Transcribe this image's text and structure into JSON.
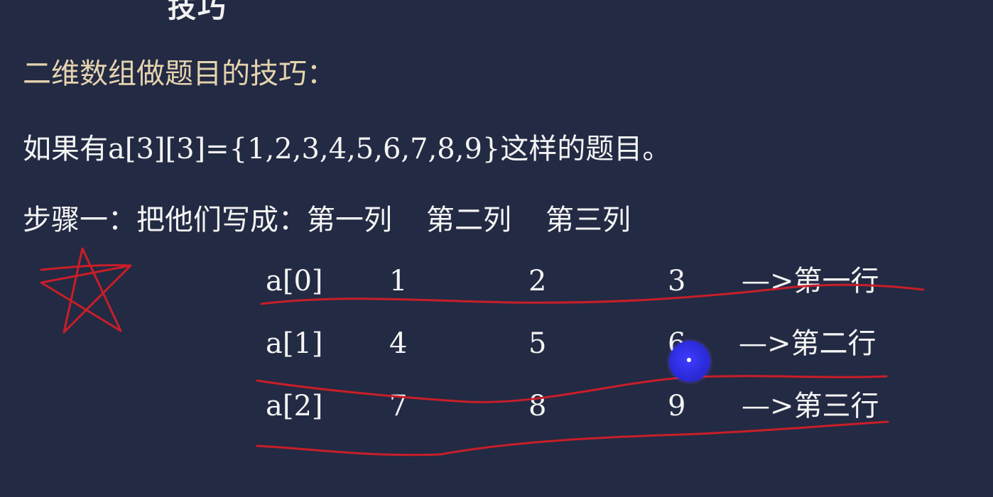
{
  "slide": {
    "top_fragment": "技巧",
    "title": "二维数组做题目的技巧：",
    "example": "如果有a[3][3]={1,2,3,4,5,6,7,8,9}这样的题目。",
    "step_prefix": "步骤一：把他们写成：",
    "column_labels": [
      "第一列",
      "第二列",
      "第三列"
    ]
  },
  "matrix": {
    "rows": [
      {
        "name": "a[0]",
        "values": [
          "1",
          "2",
          "3"
        ],
        "arrow": "—>第一行"
      },
      {
        "name": "a[1]",
        "values": [
          "4",
          "5",
          "6"
        ],
        "arrow": "—>第二行"
      },
      {
        "name": "a[2]",
        "values": [
          "7",
          "8",
          "9"
        ],
        "arrow": "—>第三行"
      }
    ]
  },
  "colors": {
    "background": "#232a43",
    "text": "#f4f4f4",
    "title": "#e6d4b0",
    "annotation_ink": "#c81e28",
    "cursor": "#2f2ce8"
  },
  "icons": {
    "star_doodle": "hand-drawn-star-icon",
    "cursor": "pointer-highlight-icon"
  }
}
